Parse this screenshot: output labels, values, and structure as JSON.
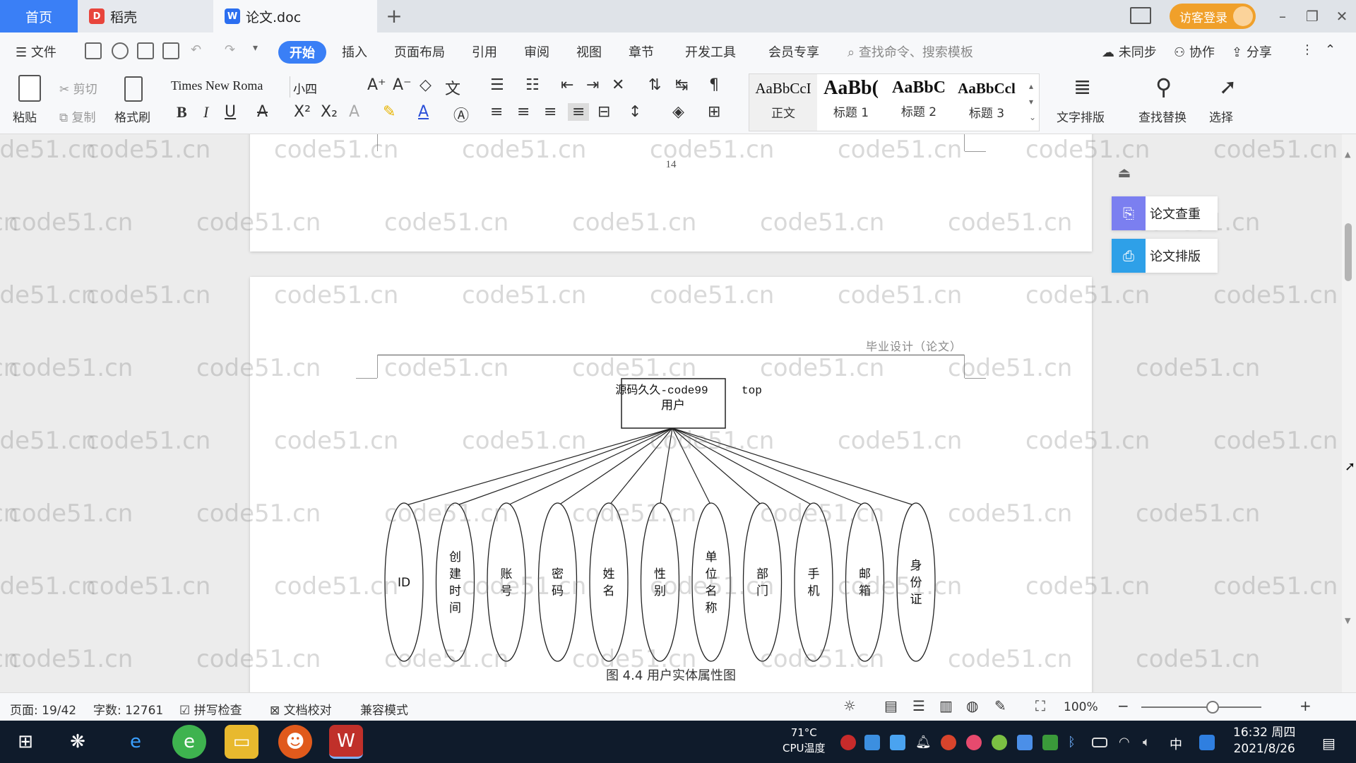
{
  "tabs": {
    "home": "首页",
    "daoke": "稻壳",
    "doc": "论文.doc",
    "add": "+"
  },
  "titlebar": {
    "login": "访客登录",
    "minimize": "–",
    "restore": "❐",
    "close": "✕"
  },
  "menu": {
    "file": "文件",
    "active_tab": "开始",
    "items": [
      "插入",
      "页面布局",
      "引用",
      "审阅",
      "视图",
      "章节",
      "开发工具",
      "会员专享"
    ],
    "search": "查找命令、搜索模板",
    "sync": "未同步",
    "collab": "协作",
    "share": "分享"
  },
  "ribbon": {
    "paste": "粘贴",
    "cut": "剪切",
    "copy": "复制",
    "format_painter": "格式刷",
    "font": "Times New Roma",
    "font_size": "小四",
    "styles": [
      {
        "sample": "AaBbCcI",
        "label": "正文"
      },
      {
        "sample": "AaBb(",
        "label": "标题 1"
      },
      {
        "sample": "AaBbC",
        "label": "标题 2"
      },
      {
        "sample": "AaBbCcl",
        "label": "标题 3"
      }
    ],
    "text_layout": "文字排版",
    "find_replace": "查找替换",
    "select": "选择"
  },
  "document": {
    "page_number": "14",
    "header_text": "毕业设计（论文）",
    "entity_line1": "源码久久-code99",
    "entity_suffix": "top",
    "entity_line2": "用户",
    "attributes": [
      "ID",
      "创建时间",
      "账号",
      "密码",
      "姓名",
      "性别",
      "单位名称",
      "部门",
      "手机",
      "邮箱",
      "身份证"
    ],
    "caption": "图 4.4  用户实体属性图",
    "watermark": "code51.cn"
  },
  "side_panel": {
    "check": "论文查重",
    "layout": "论文排版"
  },
  "status": {
    "page": "页面: 19/42",
    "words": "字数: 12761",
    "spell": "拼写检查",
    "proof": "文档校对",
    "compat": "兼容模式",
    "zoom": "100%"
  },
  "taskbar": {
    "cpu_temp": "71°C",
    "cpu_label": "CPU温度",
    "ime": "中",
    "time": "16:32 周四",
    "date": "2021/8/26"
  },
  "colors": {
    "accent": "#3a7ff6",
    "login": "#f0a02a",
    "taskbar": "#0f1b2b"
  }
}
